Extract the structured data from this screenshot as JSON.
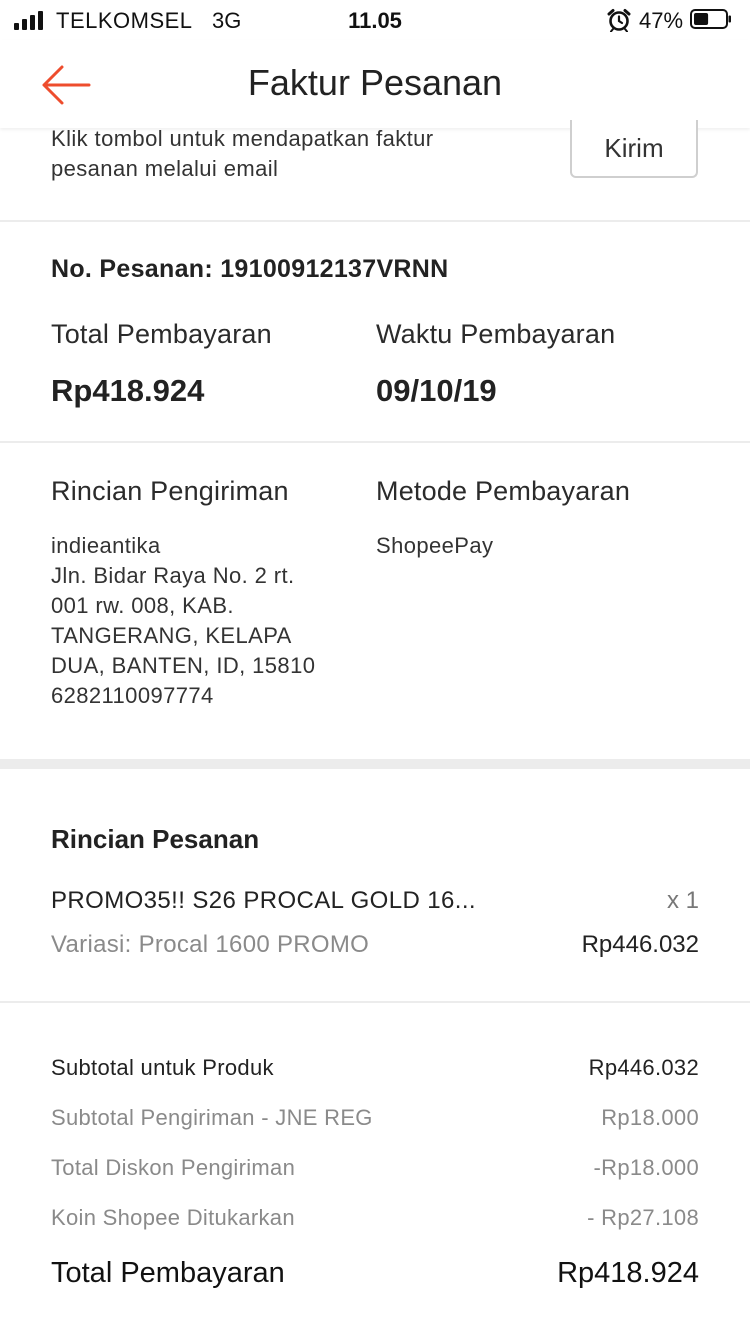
{
  "status_bar": {
    "carrier": "TELKOMSEL",
    "network": "3G",
    "time": "11.05",
    "battery_percent": "47%",
    "battery_level": 0.47
  },
  "nav": {
    "back_icon": "arrow-left-icon",
    "title": "Faktur Pesanan",
    "accent_color": "#ee4d2d"
  },
  "email_invoice": {
    "line1": "Klik tombol untuk mendapatkan faktur",
    "line2": "pesanan melalui email",
    "send_label": "Kirim"
  },
  "order": {
    "number_label": "No. Pesanan: 19100912137VRNN",
    "total_label": "Total Pembayaran",
    "total_value": "Rp418.924",
    "time_label": "Waktu Pembayaran",
    "time_value": "09/10/19"
  },
  "shipping": {
    "label": "Rincian Pengiriman",
    "address_lines": [
      "indieantika",
      "Jln. Bidar Raya No. 2 rt.",
      "001 rw. 008, KAB.",
      "TANGERANG, KELAPA",
      "DUA, BANTEN, ID, 15810",
      "6282110097774"
    ],
    "method_label": "Metode Pembayaran",
    "method_value": "ShopeePay"
  },
  "order_details": {
    "title": "Rincian Pesanan",
    "product_name": "PROMO35!! S26 PROCAL GOLD 16...",
    "quantity": "x 1",
    "variation": "Variasi: Procal 1600 PROMO",
    "price": "Rp446.032"
  },
  "summary": {
    "rows": [
      {
        "label": "Subtotal untuk Produk",
        "value": "Rp446.032"
      },
      {
        "label": "Subtotal Pengiriman - JNE REG",
        "value": "Rp18.000"
      },
      {
        "label": "Total Diskon Pengiriman",
        "value": "-Rp18.000"
      },
      {
        "label": "Koin Shopee Ditukarkan",
        "value": "- Rp27.108"
      }
    ],
    "total_label": "Total Pembayaran",
    "total_value": "Rp418.924"
  }
}
